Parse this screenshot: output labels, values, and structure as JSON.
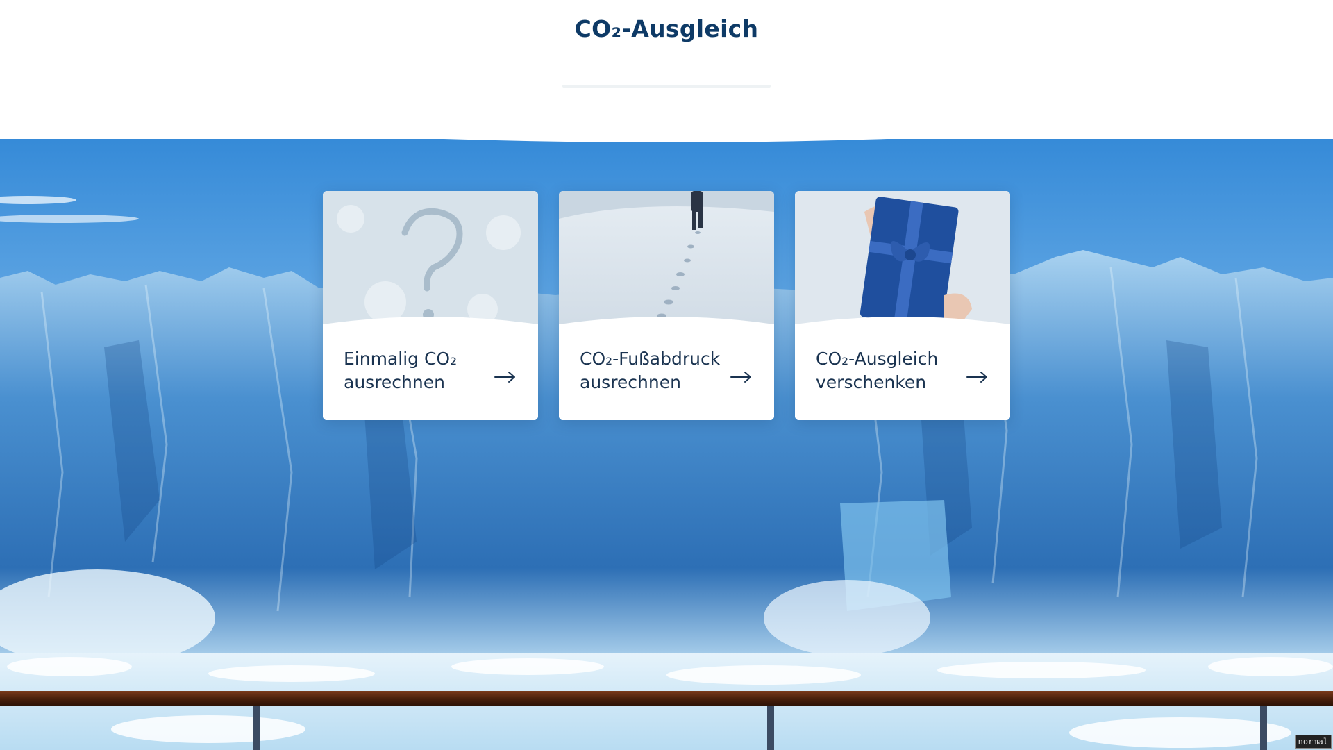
{
  "page": {
    "title": "CO₂-Ausgleich"
  },
  "cards": [
    {
      "label_line1": "Einmalig CO₂",
      "label_line2": "ausrechnen",
      "image": "snow-question-mark"
    },
    {
      "label_line1": "CO₂-Fußabdruck",
      "label_line2": "ausrechnen",
      "image": "footprints-in-snow"
    },
    {
      "label_line1": "CO₂-Ausgleich",
      "label_line2": "verschenken",
      "image": "gift-box-in-hands"
    }
  ],
  "icons": {
    "card_arrow": "arrow-right-icon"
  },
  "status": {
    "mode": "normal"
  },
  "colors": {
    "title": "#0e3a66",
    "card_text": "#1a3350",
    "sky": "#3f93d8",
    "ice": "#5fa8dc"
  }
}
